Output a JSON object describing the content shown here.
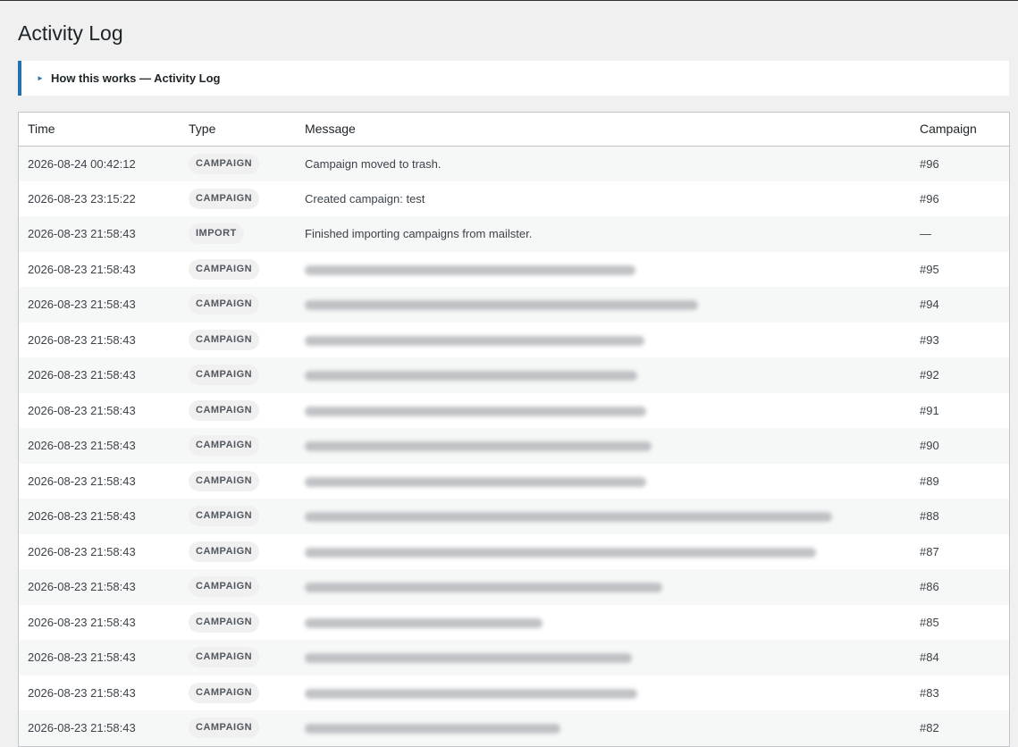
{
  "page": {
    "title": "Activity Log"
  },
  "info_box": {
    "label": "How this works — Activity Log"
  },
  "table": {
    "columns": [
      "Time",
      "Type",
      "Message",
      "Campaign"
    ],
    "rows": [
      {
        "time": "2026-08-24 00:42:12",
        "type": "CAMPAIGN",
        "message": "Campaign moved to trash.",
        "campaign": "#96",
        "redacted": false
      },
      {
        "time": "2026-08-23 23:15:22",
        "type": "CAMPAIGN",
        "message": "Created campaign: test",
        "campaign": "#96",
        "redacted": false
      },
      {
        "time": "2026-08-23 21:58:43",
        "type": "IMPORT",
        "message": "Finished importing campaigns from mailster.",
        "campaign": "—",
        "redacted": false
      },
      {
        "time": "2026-08-23 21:58:43",
        "type": "CAMPAIGN",
        "message": "",
        "campaign": "#95",
        "redacted": true
      },
      {
        "time": "2026-08-23 21:58:43",
        "type": "CAMPAIGN",
        "message": "",
        "campaign": "#94",
        "redacted": true
      },
      {
        "time": "2026-08-23 21:58:43",
        "type": "CAMPAIGN",
        "message": "",
        "campaign": "#93",
        "redacted": true
      },
      {
        "time": "2026-08-23 21:58:43",
        "type": "CAMPAIGN",
        "message": "",
        "campaign": "#92",
        "redacted": true
      },
      {
        "time": "2026-08-23 21:58:43",
        "type": "CAMPAIGN",
        "message": "",
        "campaign": "#91",
        "redacted": true
      },
      {
        "time": "2026-08-23 21:58:43",
        "type": "CAMPAIGN",
        "message": "",
        "campaign": "#90",
        "redacted": true
      },
      {
        "time": "2026-08-23 21:58:43",
        "type": "CAMPAIGN",
        "message": "",
        "campaign": "#89",
        "redacted": true
      },
      {
        "time": "2026-08-23 21:58:43",
        "type": "CAMPAIGN",
        "message": "",
        "campaign": "#88",
        "redacted": true
      },
      {
        "time": "2026-08-23 21:58:43",
        "type": "CAMPAIGN",
        "message": "",
        "campaign": "#87",
        "redacted": true
      },
      {
        "time": "2026-08-23 21:58:43",
        "type": "CAMPAIGN",
        "message": "",
        "campaign": "#86",
        "redacted": true
      },
      {
        "time": "2026-08-23 21:58:43",
        "type": "CAMPAIGN",
        "message": "",
        "campaign": "#85",
        "redacted": true
      },
      {
        "time": "2026-08-23 21:58:43",
        "type": "CAMPAIGN",
        "message": "",
        "campaign": "#84",
        "redacted": true
      },
      {
        "time": "2026-08-23 21:58:43",
        "type": "CAMPAIGN",
        "message": "",
        "campaign": "#83",
        "redacted": true
      },
      {
        "time": "2026-08-23 21:58:43",
        "type": "CAMPAIGN",
        "message": "",
        "campaign": "#82",
        "redacted": true
      }
    ]
  },
  "colors": {
    "accent": "#2271b1",
    "background": "#f0f0f1",
    "badge_bg": "#f0f0f1",
    "badge_text": "#50575e"
  }
}
